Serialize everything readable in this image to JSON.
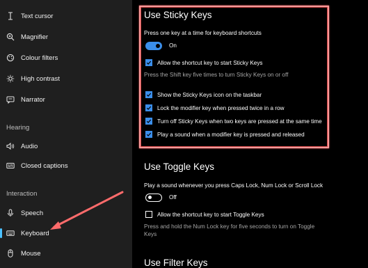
{
  "sidebar": {
    "items": [
      {
        "label": "Text cursor",
        "icon": "text-cursor-icon"
      },
      {
        "label": "Magnifier",
        "icon": "magnifier-icon"
      },
      {
        "label": "Colour filters",
        "icon": "colour-filters-icon"
      },
      {
        "label": "High contrast",
        "icon": "high-contrast-icon"
      },
      {
        "label": "Narrator",
        "icon": "narrator-icon"
      }
    ],
    "hearing_label": "Hearing",
    "hearing_items": [
      {
        "label": "Audio",
        "icon": "audio-icon"
      },
      {
        "label": "Closed captions",
        "icon": "closed-captions-icon"
      }
    ],
    "interaction_label": "Interaction",
    "interaction_items": [
      {
        "label": "Speech",
        "icon": "microphone-icon"
      },
      {
        "label": "Keyboard",
        "icon": "keyboard-icon",
        "active": true
      },
      {
        "label": "Mouse",
        "icon": "mouse-icon"
      }
    ]
  },
  "sticky": {
    "title": "Use Sticky Keys",
    "desc": "Press one key at a time for keyboard shortcuts",
    "toggle_state": "On",
    "shortcut_label": "Allow the shortcut key to start Sticky Keys",
    "shortcut_desc": "Press the Shift key five times to turn Sticky Keys on or off",
    "options": [
      "Show the Sticky Keys icon on the taskbar",
      "Lock the modifier key when pressed twice in a row",
      "Turn off Sticky Keys when two keys are pressed at the same time",
      "Play a sound when a modifier key is pressed and released"
    ]
  },
  "toggle_keys": {
    "title": "Use Toggle Keys",
    "desc": "Play a sound whenever you press Caps Lock, Num Lock or Scroll Lock",
    "toggle_state": "Off",
    "shortcut_label": "Allow the shortcut key to start Toggle Keys",
    "shortcut_desc_line1": "Press and hold the Num Lock key for five seconds to turn on Toggle",
    "shortcut_desc_line2": "Keys"
  },
  "filter_keys": {
    "title": "Use Filter Keys"
  },
  "colors": {
    "accent": "#3b8eea",
    "highlight": "#ff9a9a",
    "arrow": "#ff6b6b",
    "sidebar_bg": "#1f1f1f"
  }
}
